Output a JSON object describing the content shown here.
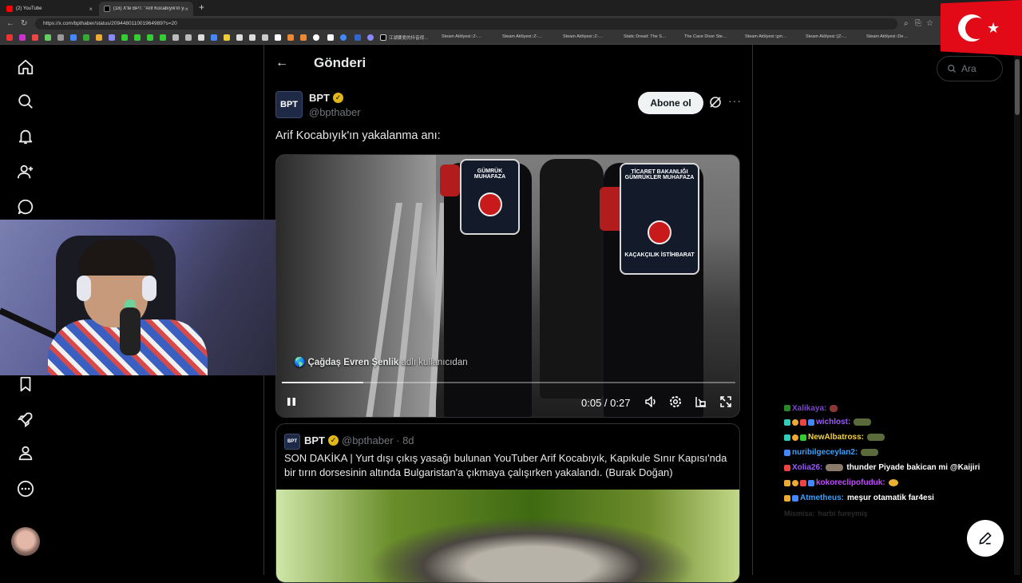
{
  "browser": {
    "tabs": [
      {
        "label": "(2) YouTube"
      },
      {
        "label": "(18) X'te BPT: \"Arif Kocabıyık'ın yakala…"
      }
    ],
    "url": "https://x.com/bpthaber/status/209448011001964989?s=20",
    "bookmarks": [
      "江湖要爱的抖音视…",
      "Steam Atölyesi::Z-…",
      "Steam Atölyesi::Z-…",
      "Steam Atölyesi::Z-…",
      "Static Dread: The S…",
      "The Cave Diver Ste…",
      "Steam Atölyesi::gm…",
      "Steam Atölyesi::[Z-…",
      "Steam Atölyesi::De…"
    ]
  },
  "overlay": {
    "flag_name": "turkey-flag",
    "flag_colors": {
      "red": "#e30a17",
      "white": "#ffffff"
    }
  },
  "header": {
    "title": "Gönderi"
  },
  "post": {
    "author_name": "BPT",
    "author_handle": "@bpthaber",
    "avatar_text": "BPT",
    "follow_label": "Abone ol",
    "text": "Arif Kocabıyık'ın yakalanma anı:",
    "video": {
      "vest_text_1": "GÜMRÜK MUHAFAZA",
      "vest_text_2": "TİCARET BAKANLIĞI GÜMRÜKLER MUHAFAZA",
      "vest_text_3": "KAÇAKÇILIK İSTİHBARAT",
      "caption_user": "Çağdaş Evren Şenlik",
      "caption_suffix": " adlı kullanıcıdan",
      "time": "0:05 / 0:27",
      "progress": 0.18
    }
  },
  "quote": {
    "author_name": "BPT",
    "author_handle": "@bpthaber · 8d",
    "avatar_text": "BPT",
    "text": "SON DAKİKA | Yurt dışı çıkış yasağı bulunan YouTuber Arif Kocabıyık, Kapıkule Sınır Kapısı'nda bir tırın dorsesinin altında Bulgaristan'a çıkmaya çalışırken yakalandı. (Burak Doğan)"
  },
  "search": {
    "placeholder": "Ara"
  },
  "chat": [
    {
      "user": "Xalikaya:",
      "color": "#9b59ff",
      "msg": ""
    },
    {
      "user": "wichlost:",
      "color": "#9b59ff",
      "msg": ""
    },
    {
      "user": "NewAlbatross:",
      "color": "#f5d33a",
      "msg": ""
    },
    {
      "user": "nuribilgeceylan2:",
      "color": "#3aa0ff",
      "msg": ""
    },
    {
      "user": "Xolia26:",
      "color": "#9b59ff",
      "msg": "thunder Piyade bakican mi @Kaijiri"
    },
    {
      "user": "kokoreclipofuduk:",
      "color": "#c24cff",
      "msg": ""
    },
    {
      "user": "Atmetheus:",
      "color": "#3aa0ff",
      "msg": "meşur otamatik far4esi"
    },
    {
      "user": "Mismisa:",
      "color": "#555555",
      "msg": "harbi fureymiş"
    }
  ]
}
